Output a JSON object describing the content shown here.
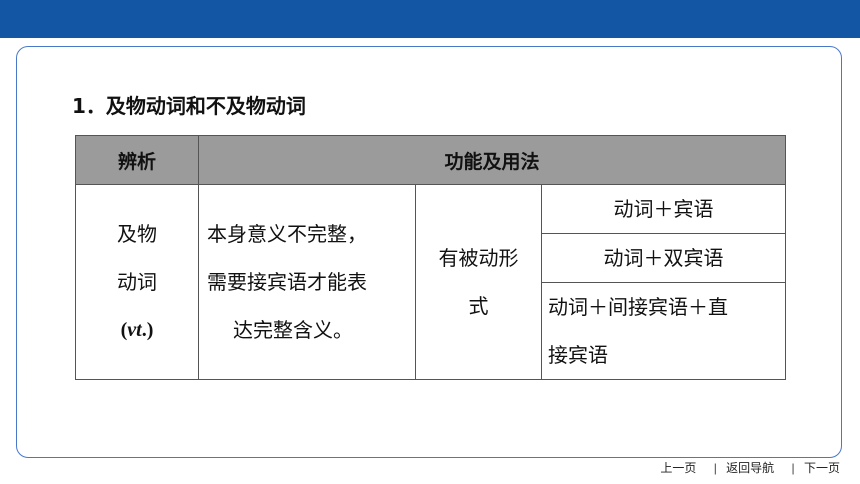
{
  "heading": "1．及物动词和不及物动词",
  "table": {
    "header": {
      "col1": "辨析",
      "col2": "功能及用法"
    },
    "term": {
      "line1": "及物",
      "line2": "动词",
      "abbr_open": "(",
      "abbr_italic": "vt",
      "abbr_close": ".)"
    },
    "description": {
      "line1": "本身意义不完整，",
      "line2": "需要接宾语才能表",
      "line3": "达完整含义。"
    },
    "passive": {
      "line1": "有被动形",
      "line2": "式"
    },
    "patterns": [
      {
        "text": "动词＋宾语"
      },
      {
        "text": "动词＋双宾语"
      },
      {
        "line1": "动词＋间接宾语＋直",
        "line2": "接宾语"
      }
    ]
  },
  "footer": {
    "prev": "上一页",
    "home": "返回导航",
    "next": "下一页",
    "separator": "|"
  },
  "colors": {
    "topbar": "#1256a4",
    "frame_border": "#4a78c8",
    "header_fill": "#9b9b9b"
  }
}
